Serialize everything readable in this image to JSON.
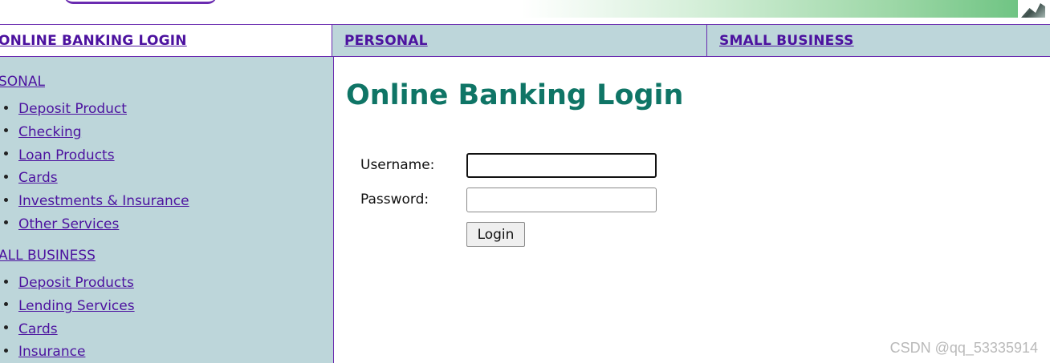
{
  "nav": {
    "login_label": "ONLINE BANKING LOGIN",
    "personal_label": "PERSONAL",
    "business_label": "SMALL BUSINESS"
  },
  "sidebar": {
    "personal_heading": "SONAL",
    "personal_items": [
      "Deposit Product",
      "Checking",
      "Loan Products",
      "Cards",
      "Investments & Insurance",
      "Other Services"
    ],
    "business_heading": "ALL BUSINESS",
    "business_items": [
      "Deposit Products",
      "Lending Services",
      "Cards",
      "Insurance"
    ]
  },
  "main": {
    "title": "Online Banking Login",
    "username_label": "Username:",
    "password_label": "Password:",
    "username_value": "",
    "password_value": "",
    "login_button": "Login"
  },
  "watermark": "CSDN @qq_53335914",
  "colors": {
    "link": "#4c129f",
    "sidebar_bg": "#bdd6da",
    "title": "#0f7566",
    "border": "#6a2bb0"
  },
  "icons": [
    "banner-logo-swoosh",
    "banner-photo"
  ]
}
